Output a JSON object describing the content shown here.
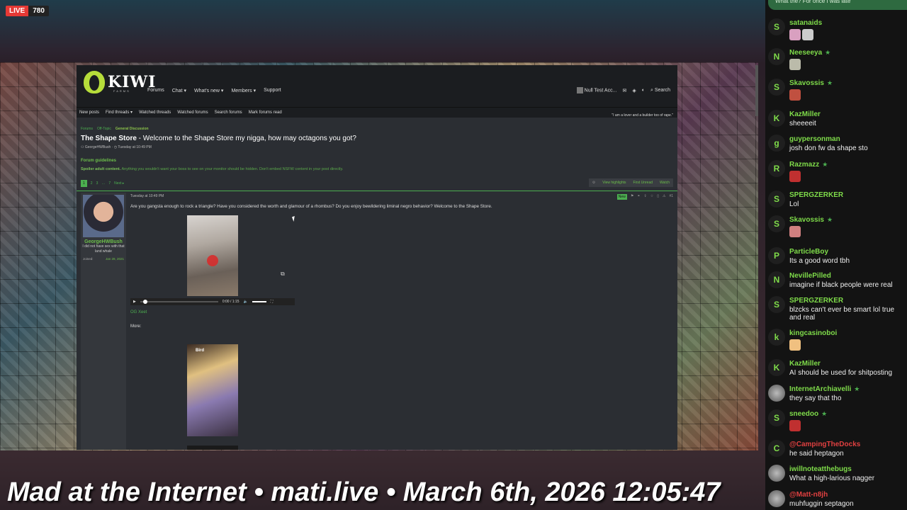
{
  "stream": {
    "live_label": "LIVE",
    "viewer_count": "780",
    "banner": "Mad at the Internet • mati.live • March 6th, 2026 12:05:47"
  },
  "forum": {
    "logo_text": "KIWI",
    "logo_sub": "FARMS",
    "nav": [
      "Forums",
      "Chat",
      "What's new",
      "Members",
      "Support"
    ],
    "user": {
      "account": "Null Test Acc...",
      "search": "Search"
    },
    "subnav": [
      "New posts",
      "Find threads",
      "Watched threads",
      "Watched forums",
      "Search forums",
      "Mark forums read"
    ],
    "quote": "\"I am a lover and a builder too of rape.\"",
    "breadcrumb": [
      "Forums",
      "Off-Topic",
      "General Discussion"
    ],
    "thread": {
      "prefix": "The Shape Store",
      "title": "Welcome to the Shape Store my nigga, how may octagons you got?",
      "author": "GeorgeHWBush",
      "date": "Tuesday at 10:49 PM"
    },
    "guidelines": "Forum guidelines",
    "spoiler_bold": "Spoiler adult content.",
    "spoiler_text": "Anything you wouldn't want your boss to see on your monitor should be hidden. Don't embed NSFW content in your post directly.",
    "pages": [
      "1",
      "2",
      "3",
      "…",
      "7",
      "Next"
    ],
    "tools": [
      "View highlights",
      "First Unread",
      "Watch"
    ],
    "post": {
      "username": "GeorgeHWBush",
      "user_title": "I did not have sex with that land whale",
      "joined_label": "Joined:",
      "joined": "Jan 28, 2021",
      "date": "Tuesday at 10:49 PM",
      "new_badge": "New",
      "number": "#1",
      "text": "Are you gangsta enough to rock a triangle? Have you considered the worth and glamour of a rhombus? Do you enjoy bewildering liminal negro behavior? Welcome to the Shape Store.",
      "video_time": "0:00 / 1:15",
      "og_link": "OG Xeet",
      "more": "More:",
      "video2_tag": "Bird"
    }
  },
  "chat": {
    "pinned": "What the? For once I was late",
    "messages": [
      {
        "user": "satanaids",
        "text": "",
        "icon": "S",
        "color": "#7fdc4a",
        "star": false
      },
      {
        "user": "Neeseeya",
        "text": "",
        "icon": "N",
        "color": "#7fdc4a",
        "star": true
      },
      {
        "user": "Skavossis",
        "text": "",
        "icon": "S",
        "color": "#7fdc4a",
        "star": true
      },
      {
        "user": "KazMiller",
        "text": "sheeeeit",
        "icon": "K",
        "color": "#7fdc4a",
        "star": false
      },
      {
        "user": "guypersonman",
        "text": "josh don fw da shape sto",
        "icon": "g",
        "color": "#7fdc4a",
        "star": false
      },
      {
        "user": "Razmazz",
        "text": "",
        "icon": "R",
        "color": "#7fdc4a",
        "star": true
      },
      {
        "user": "SPERGZERKER",
        "text": "Lol",
        "icon": "S",
        "color": "#7fdc4a",
        "star": false
      },
      {
        "user": "Skavossis",
        "text": "",
        "icon": "S",
        "color": "#7fdc4a",
        "star": true
      },
      {
        "user": "ParticleBoy",
        "text": "Its a good word tbh",
        "icon": "P",
        "color": "#7fdc4a",
        "star": false
      },
      {
        "user": "NevillePilled",
        "text": "imagine if black people were real",
        "icon": "N",
        "color": "#7fdc4a",
        "star": false
      },
      {
        "user": "SPERGZERKER",
        "text": "blzcks can't ever be smart lol true and real",
        "icon": "S",
        "color": "#7fdc4a",
        "star": false
      },
      {
        "user": "kingcasinoboi",
        "text": "",
        "icon": "k",
        "color": "#7fdc4a",
        "star": false
      },
      {
        "user": "KazMiller",
        "text": "AI should be used for shitposting",
        "icon": "K",
        "color": "#7fdc4a",
        "star": false
      },
      {
        "user": "InternetArchiavelli",
        "text": "they say that tho",
        "icon": "",
        "color": "#7fdc4a",
        "star": true
      },
      {
        "user": "sneedoo",
        "text": "",
        "icon": "S",
        "color": "#7fdc4a",
        "star": true
      },
      {
        "user": "@CampingTheDocks",
        "text": "he said heptagon",
        "icon": "C",
        "color": "#e04040",
        "star": false
      },
      {
        "user": "iwillnoteatthebugs",
        "text": "What a high-larious nagger",
        "icon": "",
        "color": "#7fdc4a",
        "star": false
      },
      {
        "user": "@Matt-n8jh",
        "text": "muhfuggin septagon",
        "icon": "",
        "color": "#e04040",
        "star": false
      }
    ]
  },
  "colors": {
    "accent": "#4caf50",
    "chat_name": "#7fdc4a",
    "live": "#e53935"
  }
}
